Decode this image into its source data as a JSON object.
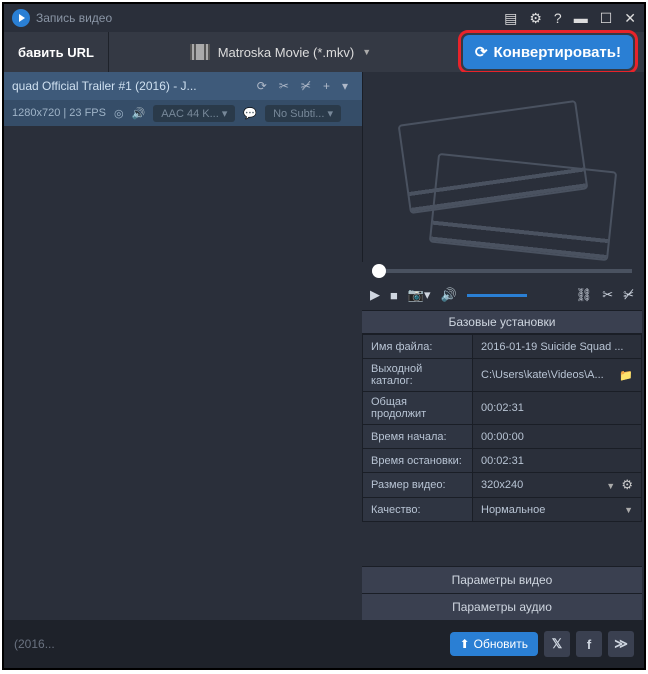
{
  "titlebar": {
    "title": "Запись видео"
  },
  "toolbar": {
    "add_url": "бавить URL",
    "format": "Matroska Movie (*.mkv)",
    "convert": "Конвертировать!"
  },
  "item": {
    "title": "quad Official Trailer #1 (2016) - J...",
    "resolution": "1280x720 | 23 FPS",
    "audio": "AAC 44 K...",
    "subtitle": "No Subti..."
  },
  "settings": {
    "header": "Базовые установки",
    "rows": [
      {
        "label": "Имя файла:",
        "value": "2016-01-19 Suicide Squad ..."
      },
      {
        "label": "Выходной каталог:",
        "value": "C:\\Users\\kate\\Videos\\A..."
      },
      {
        "label": "Общая продолжит",
        "value": "00:02:31"
      },
      {
        "label": "Время начала:",
        "value": "00:00:00"
      },
      {
        "label": "Время остановки:",
        "value": "00:02:31"
      },
      {
        "label": "Размер видео:",
        "value": "320x240"
      },
      {
        "label": "Качество:",
        "value": "Нормальное"
      }
    ],
    "params_video": "Параметры видео",
    "params_audio": "Параметры аудио"
  },
  "statusbar": {
    "left": "(2016...",
    "refresh": "Обновить"
  }
}
